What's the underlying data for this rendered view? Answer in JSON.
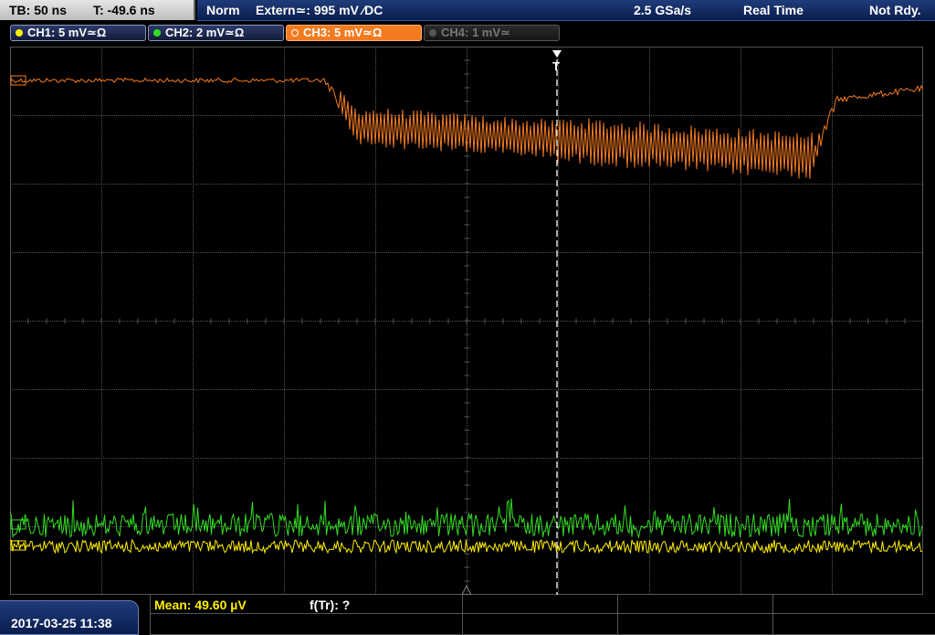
{
  "topbar": {
    "timebase": "TB: 50 ns",
    "trigger_time": "T: -49.6 ns",
    "trigger_mode": "Norm",
    "trigger_source": "Extern≃: 995 mV ∕DC",
    "sample_rate": "2.5 GSa/s",
    "acquisition_mode": "Real Time",
    "status": "Not Rdy."
  },
  "channels": [
    {
      "label": "CH1: 5 mV≃Ω",
      "color": "#ffee00",
      "state": "on"
    },
    {
      "label": "CH2: 2 mV≃Ω",
      "color": "#33dd22",
      "state": "on"
    },
    {
      "label": "CH3: 5 mV≃Ω",
      "color": "#f37b1f",
      "state": "active"
    },
    {
      "label": "CH4: 1 mV≃",
      "color": "#777777",
      "state": "off"
    }
  ],
  "screen": {
    "grid_divisions": {
      "horizontal": 10,
      "vertical": 8
    },
    "grid_color": "#555555",
    "trigger_marker": "T",
    "traces": {
      "ch1_color": "#ffee00",
      "ch2_color": "#33dd22",
      "ch3_color": "#f37b1f"
    }
  },
  "bottombar": {
    "datetime": "2017-03-25 11:38",
    "mean": "Mean: 49.60 µV",
    "f_tr": "f(Tr): ?"
  }
}
